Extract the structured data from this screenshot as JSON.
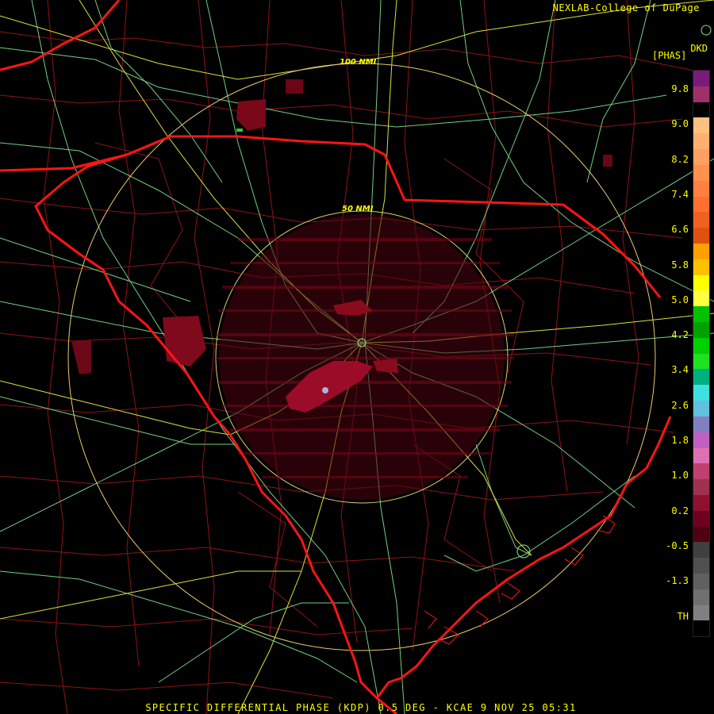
{
  "header": {
    "credit": "NEXLAB-College of DuPage",
    "site_code": "DKD",
    "units": "[PHAS]"
  },
  "footer": {
    "caption": "SPECIFIC DIFFERENTIAL PHASE (KDP) 0.5 DEG - KCAE 9 NOV 25 05:31"
  },
  "range_rings": {
    "outer_label": "100 NMI",
    "inner_label": "50 NMI"
  },
  "color_scale": {
    "labels": [
      "9.8",
      "9.0",
      "8.2",
      "7.4",
      "6.6",
      "5.8",
      "5.0",
      "4.2",
      "3.4",
      "2.6",
      "1.8",
      "1.0",
      "0.2",
      "-0.5",
      "-1.3",
      "TH"
    ],
    "swatches": [
      "#7a1a7a",
      "#a0306a",
      "#000000",
      "#ffc080",
      "#ffb070",
      "#ffa060",
      "#ff9050",
      "#ff8040",
      "#ff7030",
      "#f06020",
      "#e05010",
      "#ffa000",
      "#ffc000",
      "#ffff00",
      "#ffff40",
      "#00c000",
      "#00a000",
      "#00d000",
      "#20e020",
      "#00b080",
      "#40e0e0",
      "#60c0e0",
      "#8080c0",
      "#c060c0",
      "#e070b0",
      "#c04070",
      "#a03050",
      "#901030",
      "#700020",
      "#500010",
      "#404040",
      "#505050",
      "#606060",
      "#707070",
      "#808080",
      "#000000"
    ]
  },
  "colors": {
    "state_border": "#ff1010",
    "county_line": "#b01818",
    "highway": "#80e890",
    "interstate": "#e0e040",
    "ring": "#e8d070",
    "echo": "#8b0a1e"
  }
}
